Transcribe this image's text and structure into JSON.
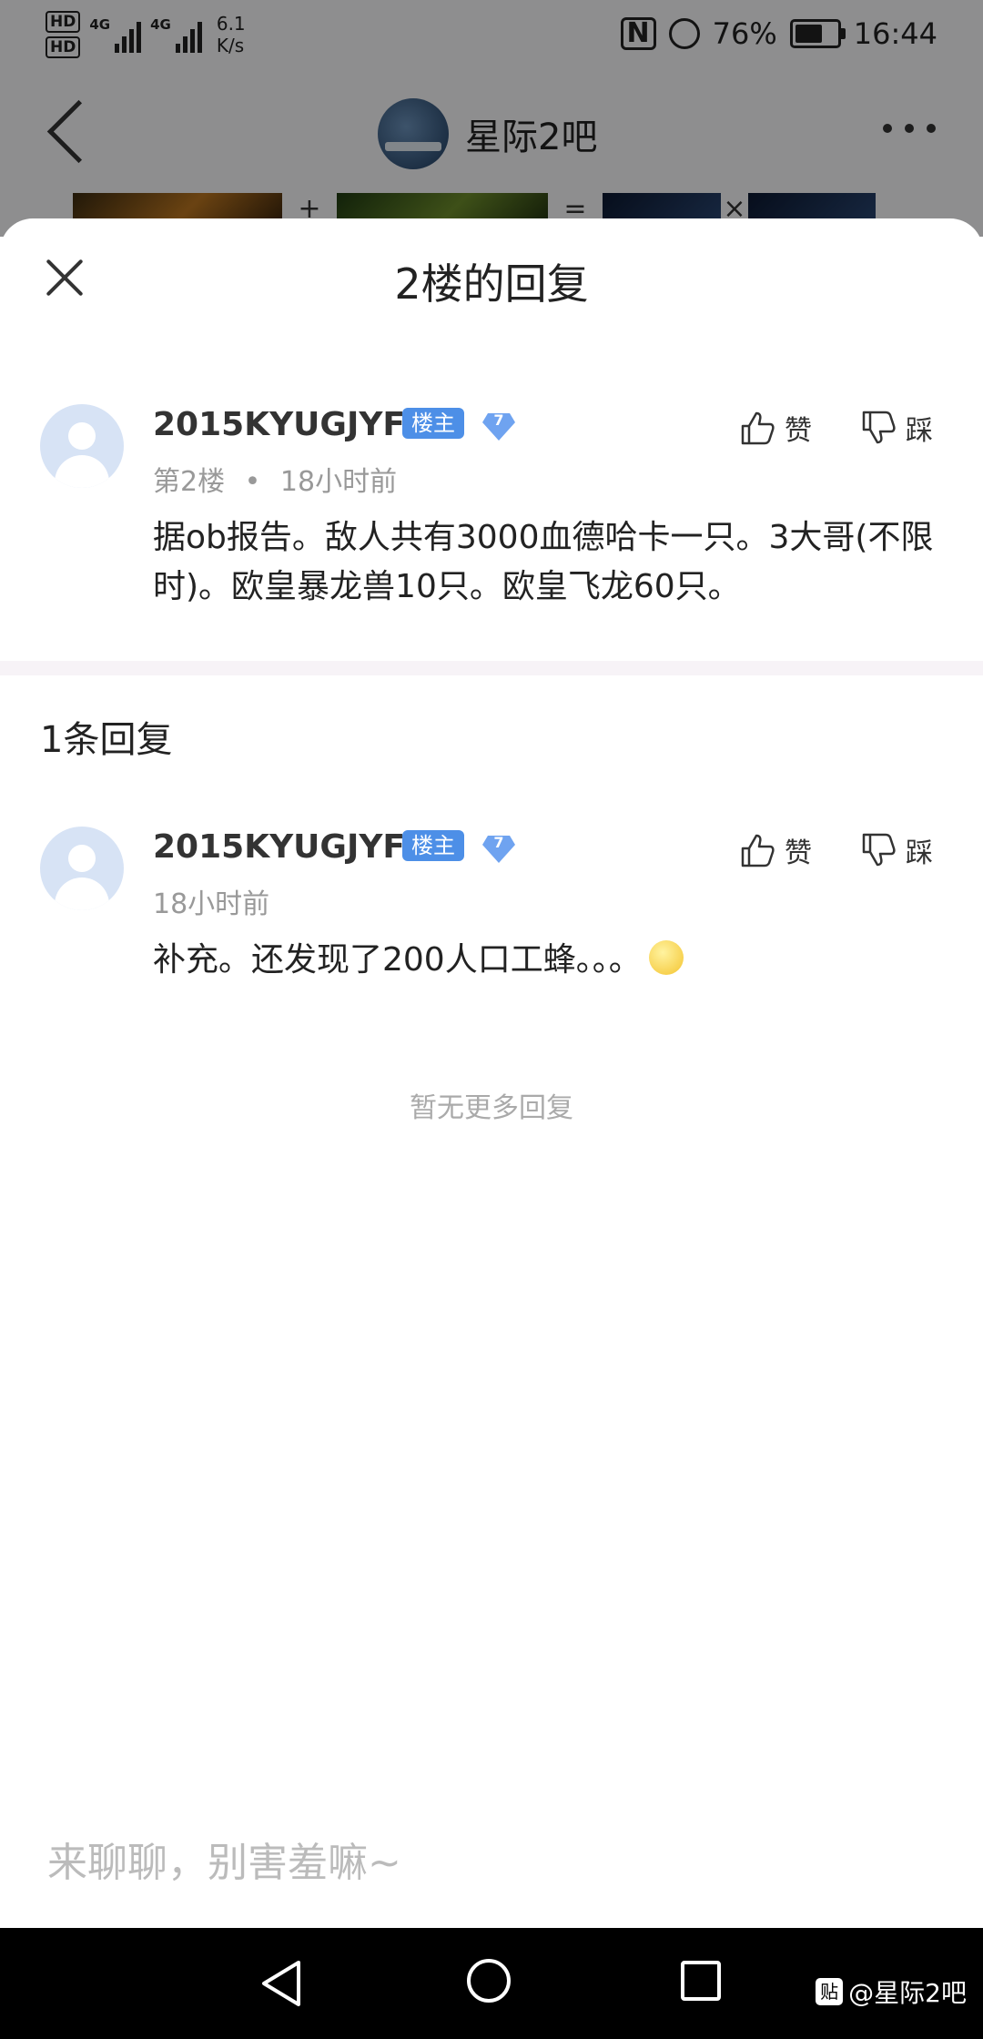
{
  "status_bar": {
    "hd1": "HD",
    "hd2": "HD",
    "net1": "4G",
    "net2": "4G",
    "speed_value": "6.1",
    "speed_unit": "K/s",
    "battery_percent": "76%",
    "battery_level": 0.76,
    "time": "16:44"
  },
  "nav": {
    "forum_name": "星际2吧"
  },
  "thumbs": {
    "plus": "+",
    "equals": "=",
    "times": "×"
  },
  "sheet": {
    "title": "2楼的回复",
    "main_post": {
      "username": "2015KYUGJYF",
      "owner_badge": "楼主",
      "level": "7",
      "floor": "第2楼",
      "dot": "•",
      "time": "18小时前",
      "content": "据ob报告。敌人共有3000血德哈卡一只。3大哥(不限时)。欧皇暴龙兽10只。欧皇飞龙60只。",
      "like_label": "赞",
      "dislike_label": "踩"
    },
    "replies_count": "1条回复",
    "replies": [
      {
        "username": "2015KYUGJYF",
        "owner_badge": "楼主",
        "level": "7",
        "time": "18小时前",
        "content": "补充。还发现了200人口工蜂。。。",
        "like_label": "赞",
        "dislike_label": "踩"
      }
    ],
    "no_more": "暂无更多回复",
    "input_placeholder": "来聊聊，别害羞嘛~"
  },
  "watermark": {
    "logo": "贴",
    "text": "@星际2吧"
  },
  "colors": {
    "owner_badge": "#4d8fe7",
    "level_badge": "#6fa3f0",
    "avatar": "#d7e3f5",
    "system_nav": "#000000"
  },
  "icons": [
    "back-icon",
    "more-icon",
    "close-icon",
    "thumbs-up-icon",
    "thumbs-down-icon",
    "nav-back-icon",
    "nav-home-icon",
    "nav-recents-icon"
  ]
}
